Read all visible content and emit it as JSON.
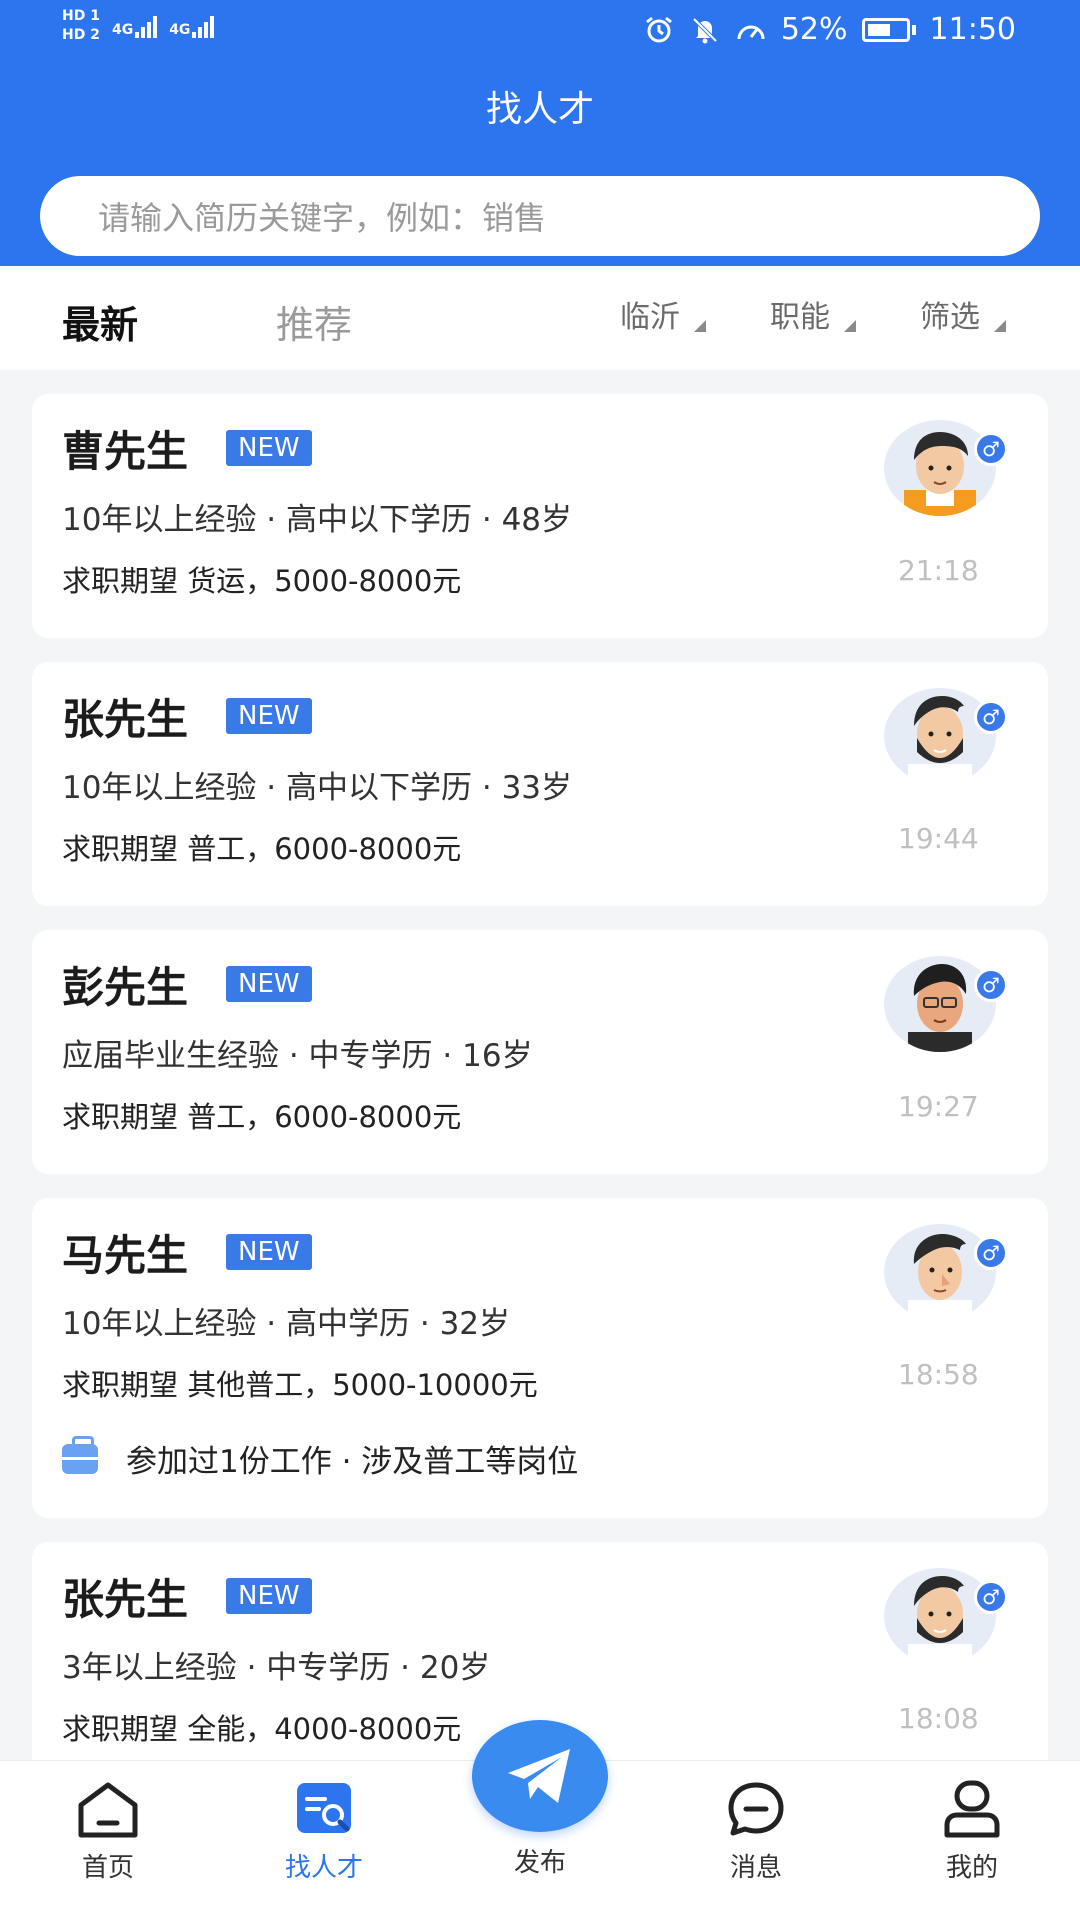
{
  "status_bar": {
    "hd1": "HD 1",
    "hd2": "HD 2",
    "net1": "4G",
    "net2": "4G",
    "battery_percent": "52%",
    "time": "11:50"
  },
  "header": {
    "title": "找人才"
  },
  "search": {
    "placeholder": "请输入简历关键字，例如：销售"
  },
  "tabs": {
    "latest": "最新",
    "recommend": "推荐"
  },
  "filters": {
    "city": "临沂",
    "function": "职能",
    "filter": "筛选"
  },
  "candidates": [
    {
      "name": "曹先生",
      "badge": "NEW",
      "info": "10年以上经验 · 高中以下学历 · 48岁",
      "hope": "求职期望 货运，5000-8000元",
      "time": "21:18",
      "gender_icon": "male-icon"
    },
    {
      "name": "张先生",
      "badge": "NEW",
      "info": "10年以上经验 · 高中以下学历 · 33岁",
      "hope": "求职期望 普工，6000-8000元",
      "time": "19:44",
      "gender_icon": "male-icon"
    },
    {
      "name": "彭先生",
      "badge": "NEW",
      "info": "应届毕业生经验 · 中专学历 · 16岁",
      "hope": "求职期望 普工，6000-8000元",
      "time": "19:27",
      "gender_icon": "male-icon"
    },
    {
      "name": "马先生",
      "badge": "NEW",
      "info": "10年以上经验 · 高中学历 · 32岁",
      "hope": "求职期望 其他普工，5000-10000元",
      "time": "18:58",
      "extra": "参加过1份工作 · 涉及普工等岗位",
      "gender_icon": "male-icon"
    },
    {
      "name": "张先生",
      "badge": "NEW",
      "info": "3年以上经验 · 中专学历 · 20岁",
      "hope": "求职期望 全能，4000-8000元",
      "time": "18:08",
      "gender_icon": "male-icon"
    }
  ],
  "bottom_nav": {
    "home": "首页",
    "find_talent": "找人才",
    "publish": "发布",
    "messages": "消息",
    "mine": "我的"
  },
  "colors": {
    "brand": "#2c75ee",
    "badge": "#3a79e8",
    "background": "#f4f5f7"
  }
}
